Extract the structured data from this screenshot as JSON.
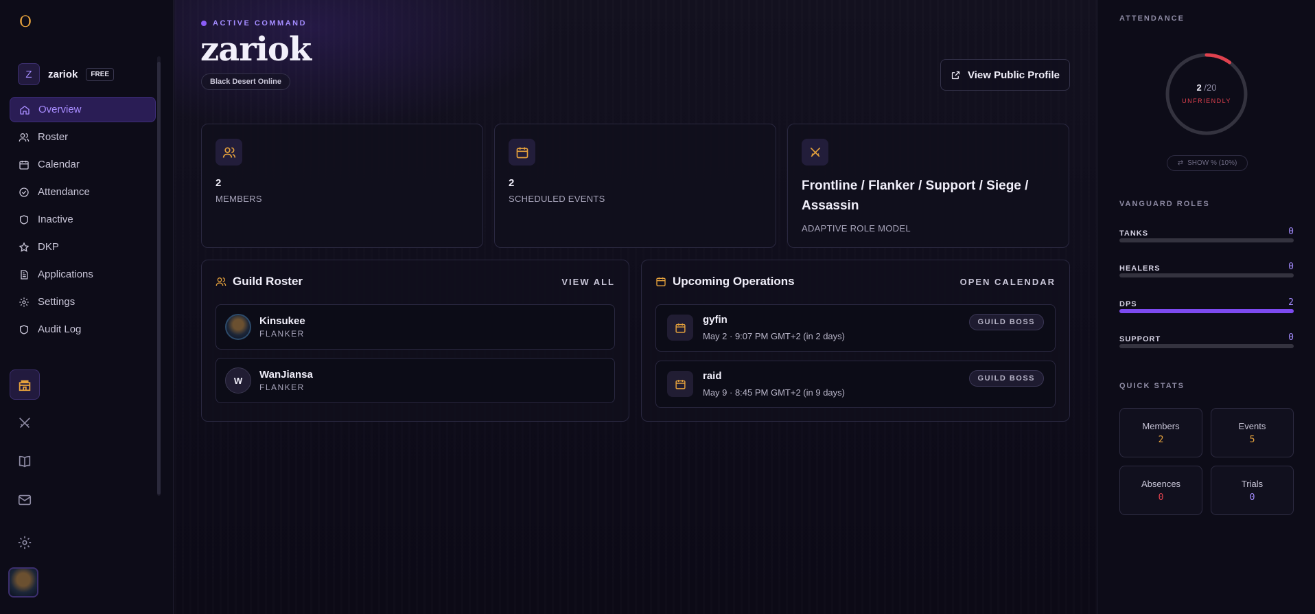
{
  "brand": {
    "logo_glyph": "O",
    "accent": "#e6a23c"
  },
  "guild": {
    "initial": "Z",
    "name": "zariok",
    "plan": "FREE"
  },
  "nav": [
    {
      "label": "Overview",
      "icon": "home-icon",
      "active": true
    },
    {
      "label": "Roster",
      "icon": "users-icon"
    },
    {
      "label": "Calendar",
      "icon": "calendar-icon"
    },
    {
      "label": "Attendance",
      "icon": "check-circle-icon"
    },
    {
      "label": "Inactive",
      "icon": "shield-icon"
    },
    {
      "label": "DKP",
      "icon": "star-icon"
    },
    {
      "label": "Applications",
      "icon": "document-icon"
    },
    {
      "label": "Settings",
      "icon": "gear-icon"
    },
    {
      "label": "Audit Log",
      "icon": "shield-icon"
    }
  ],
  "rail": [
    "castle-icon",
    "crossed-swords-icon",
    "book-icon",
    "mail-icon",
    "gear-icon"
  ],
  "header": {
    "eyebrow": "ACTIVE COMMAND",
    "title": "zariok",
    "game": "Black Desert Online",
    "profile_button": "View Public Profile"
  },
  "stats": {
    "members": {
      "value": "2",
      "label": "MEMBERS"
    },
    "events": {
      "value": "2",
      "label": "SCHEDULED EVENTS"
    },
    "roles": {
      "value": "Frontline / Flanker / Support / Siege / Assassin",
      "label": "ADAPTIVE ROLE MODEL"
    }
  },
  "roster": {
    "title": "Guild Roster",
    "link": "VIEW ALL",
    "members": [
      {
        "name": "Kinsukee",
        "role": "FLANKER",
        "avatar": "image"
      },
      {
        "name": "WanJiansa",
        "role": "FLANKER",
        "avatar": "W"
      }
    ]
  },
  "operations": {
    "title": "Upcoming Operations",
    "link": "OPEN CALENDAR",
    "events": [
      {
        "name": "gyfin",
        "time": "May 2 · 9:07 PM GMT+2 (in 2 days)",
        "badge": "GUILD BOSS"
      },
      {
        "name": "raid",
        "time": "May 9 · 8:45 PM GMT+2 (in 9 days)",
        "badge": "GUILD BOSS"
      }
    ]
  },
  "attendance": {
    "title": "ATTENDANCE",
    "value": "2",
    "max": "/20",
    "fraction": 0.1,
    "status": "UNFRIENDLY",
    "status_color": "#e0414e",
    "toggle": "SHOW % (10%)"
  },
  "roles": {
    "title": "VANGUARD ROLES",
    "items": [
      {
        "name": "TANKS",
        "count": "0",
        "fraction": 0
      },
      {
        "name": "HEALERS",
        "count": "0",
        "fraction": 0
      },
      {
        "name": "DPS",
        "count": "2",
        "fraction": 1
      },
      {
        "name": "SUPPORT",
        "count": "0",
        "fraction": 0
      }
    ]
  },
  "quick_stats": {
    "title": "QUICK STATS",
    "items": [
      {
        "label": "Members",
        "value": "2",
        "color": "#e6a23c"
      },
      {
        "label": "Events",
        "value": "5",
        "color": "#e6a23c"
      },
      {
        "label": "Absences",
        "value": "0",
        "color": "#e0414e"
      },
      {
        "label": "Trials",
        "value": "0",
        "color": "#a48cff"
      }
    ]
  }
}
